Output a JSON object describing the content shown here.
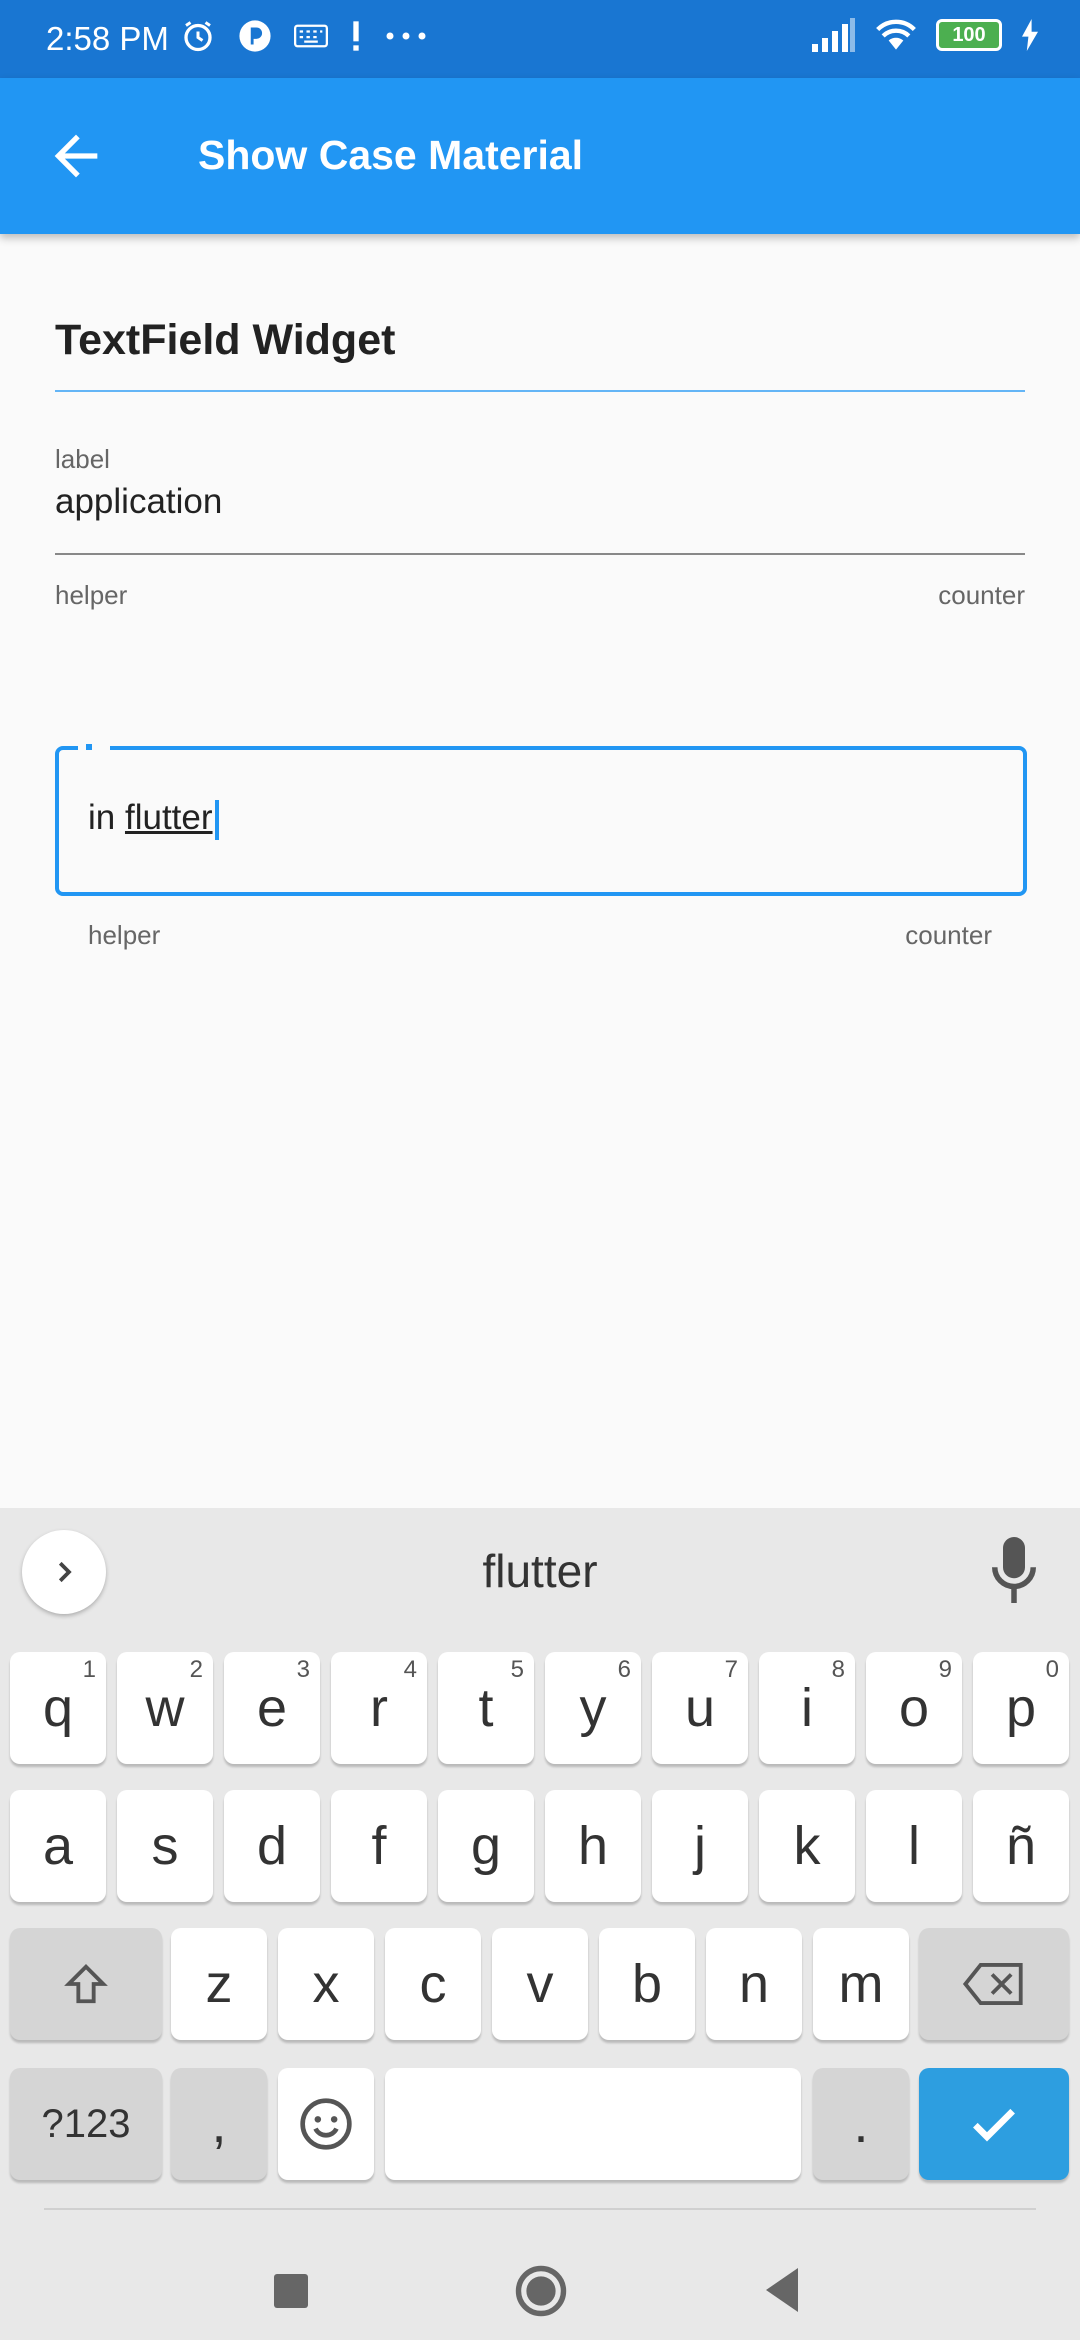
{
  "status_bar": {
    "time": "2:58 PM",
    "icons_left": [
      "alarm-icon",
      "circle-app-icon",
      "keyboard-icon",
      "alert-icon",
      "more-icon"
    ],
    "icons_right": [
      "signal-icon",
      "wifi-icon",
      "battery-icon",
      "charging-icon"
    ],
    "battery_level": "100"
  },
  "app_bar": {
    "title": "Show Case Material",
    "back_icon": "arrow-back-icon"
  },
  "content": {
    "section_title": "TextField Widget",
    "field1": {
      "label": "label",
      "value": "application",
      "helper": "helper",
      "counter": "counter"
    },
    "field2": {
      "prefix_word": "in",
      "current_word": "flutter",
      "helper": "helper",
      "counter": "counter"
    }
  },
  "keyboard": {
    "suggestion": "flutter",
    "row1": [
      {
        "key": "q",
        "hint": "1"
      },
      {
        "key": "w",
        "hint": "2"
      },
      {
        "key": "e",
        "hint": "3"
      },
      {
        "key": "r",
        "hint": "4"
      },
      {
        "key": "t",
        "hint": "5"
      },
      {
        "key": "y",
        "hint": "6"
      },
      {
        "key": "u",
        "hint": "7"
      },
      {
        "key": "i",
        "hint": "8"
      },
      {
        "key": "o",
        "hint": "9"
      },
      {
        "key": "p",
        "hint": "0"
      }
    ],
    "row2": [
      "a",
      "s",
      "d",
      "f",
      "g",
      "h",
      "j",
      "k",
      "l",
      "ñ"
    ],
    "row3": [
      "z",
      "x",
      "c",
      "v",
      "b",
      "n",
      "m"
    ],
    "symbols_label": "?123",
    "comma": ",",
    "period": ".",
    "accent_color": "#2d9ee0"
  },
  "colors": {
    "primary": "#2196f3",
    "status_bar": "#1976d2"
  }
}
